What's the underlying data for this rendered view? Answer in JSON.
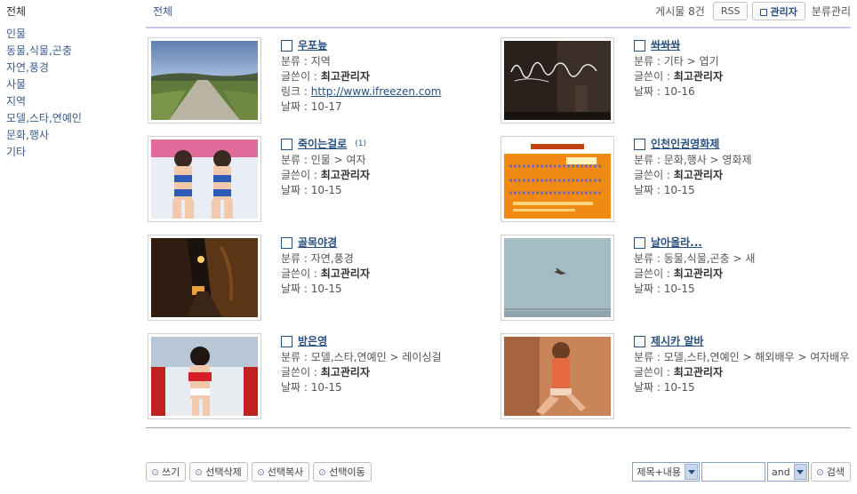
{
  "sidebar": {
    "all": "전체",
    "categories": [
      "인물",
      "동물,식물,곤충",
      "자연,풍경",
      "사물",
      "지역",
      "모델,스타,연예인",
      "문화,행사",
      "기타"
    ]
  },
  "header": {
    "crumb": "전체",
    "count": "게시물 8건",
    "rss": "RSS",
    "admin": "관리자",
    "manage": "분류관리"
  },
  "labels": {
    "category": "분류 : ",
    "author": "글쓴이 : ",
    "link": "링크 : ",
    "date": "날짜 : "
  },
  "posts": [
    {
      "title": "우포늪",
      "comments": "",
      "category": "지역",
      "author": "최고관리자",
      "link": "http://www.ifreezen.com",
      "date": "10-17",
      "image": "road-photo"
    },
    {
      "title": "쏴쏴쏴",
      "comments": "",
      "category": "기타 > 엽기",
      "author": "최고관리자",
      "link": "",
      "date": "10-16",
      "image": "lightpainting-photo"
    },
    {
      "title": "죽이는걸로",
      "comments": "(1)",
      "category": "인물 > 여자",
      "author": "최고관리자",
      "link": "",
      "date": "10-15",
      "image": "models-photo"
    },
    {
      "title": "인천인권영화제",
      "comments": "",
      "category": "문화,행사 > 영화제",
      "author": "최고관리자",
      "link": "",
      "date": "10-15",
      "image": "poster-photo"
    },
    {
      "title": "골목야경",
      "comments": "",
      "category": "자연,풍경",
      "author": "최고관리자",
      "link": "",
      "date": "10-15",
      "image": "alley-night-photo"
    },
    {
      "title": "날아올라...",
      "comments": "",
      "category": "동물,식물,곤충 > 새",
      "author": "최고관리자",
      "link": "",
      "date": "10-15",
      "image": "bird-sky-photo"
    },
    {
      "title": "방은영",
      "comments": "",
      "category": "모델,스타,연예인 > 레이싱걸",
      "author": "최고관리자",
      "link": "",
      "date": "10-15",
      "image": "racing-model-photo"
    },
    {
      "title": "제시카 알바",
      "comments": "",
      "category": "모델,스타,연예인 > 해외배우 > 여자배우",
      "author": "최고관리자",
      "link": "",
      "date": "10-15",
      "image": "actress-photo"
    }
  ],
  "footer": {
    "buttons": [
      "쓰기",
      "선택삭제",
      "선택복사",
      "선택이동"
    ],
    "search_field": "제목+내용",
    "search_value": "",
    "search_op": "and",
    "search_button": "검색"
  }
}
